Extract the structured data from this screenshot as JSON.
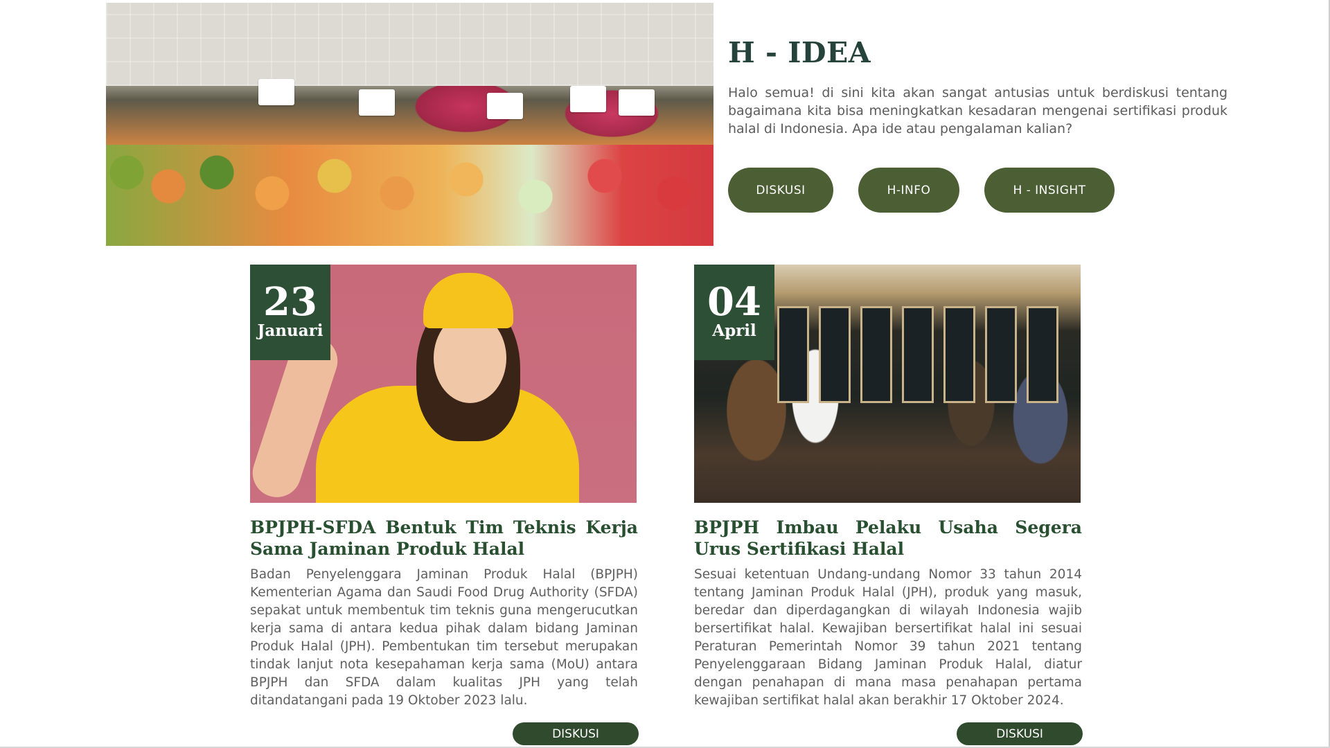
{
  "hero": {
    "title": "H - IDEA",
    "description": "Halo semua! di sini kita akan sangat antusias untuk berdiskusi tentang bagaimana kita bisa meningkatkan kesadaran mengenai sertifikasi produk halal di Indonesia. Apa ide atau pengalaman kalian?",
    "buttons": [
      "DISKUSI",
      "H-INFO",
      "H - INSIGHT"
    ]
  },
  "articles": [
    {
      "day": "23",
      "month": "Januari",
      "title": "BPJPH-SFDA Bentuk Tim Teknis Kerja Sama Jaminan Produk Halal",
      "text": "Badan Penyelenggara Jaminan Produk Halal (BPJPH) Kementerian Agama dan Saudi Food Drug Authority (SFDA) sepakat untuk membentuk tim teknis guna mengerucutkan kerja sama di antara kedua pihak dalam bidang Jaminan Produk Halal (JPH). Pembentukan tim tersebut merupakan tindak lanjut nota kesepahaman kerja sama (MoU) antara BPJPH dan SFDA dalam kualitas JPH yang telah ditandatangani pada 19 Oktober 2023 lalu.",
      "button": "DISKUSI"
    },
    {
      "day": "04",
      "month": "April",
      "title": "BPJPH Imbau Pelaku Usaha Segera Urus Sertifikasi Halal",
      "text": "Sesuai ketentuan Undang-undang Nomor 33 tahun 2014 tentang Jaminan Produk Halal (JPH), produk yang masuk, beredar dan diperdagangkan di wilayah Indonesia wajib bersertifikat halal. Kewajiban bersertifikat halal ini sesuai Peraturan Pemerintah Nomor 39 tahun 2021 tentang Penyelenggaraan Bidang Jaminan Produk Halal, diatur dengan penahapan di mana masa penahapan pertama kewajiban sertifikat halal akan berakhir 17 Oktober 2024.",
      "button": "DISKUSI"
    }
  ],
  "colors": {
    "primary_button": "#4c5e34",
    "card_button": "#2f4a2c",
    "date_badge": "#2d4f36",
    "title_text": "#294f31"
  }
}
